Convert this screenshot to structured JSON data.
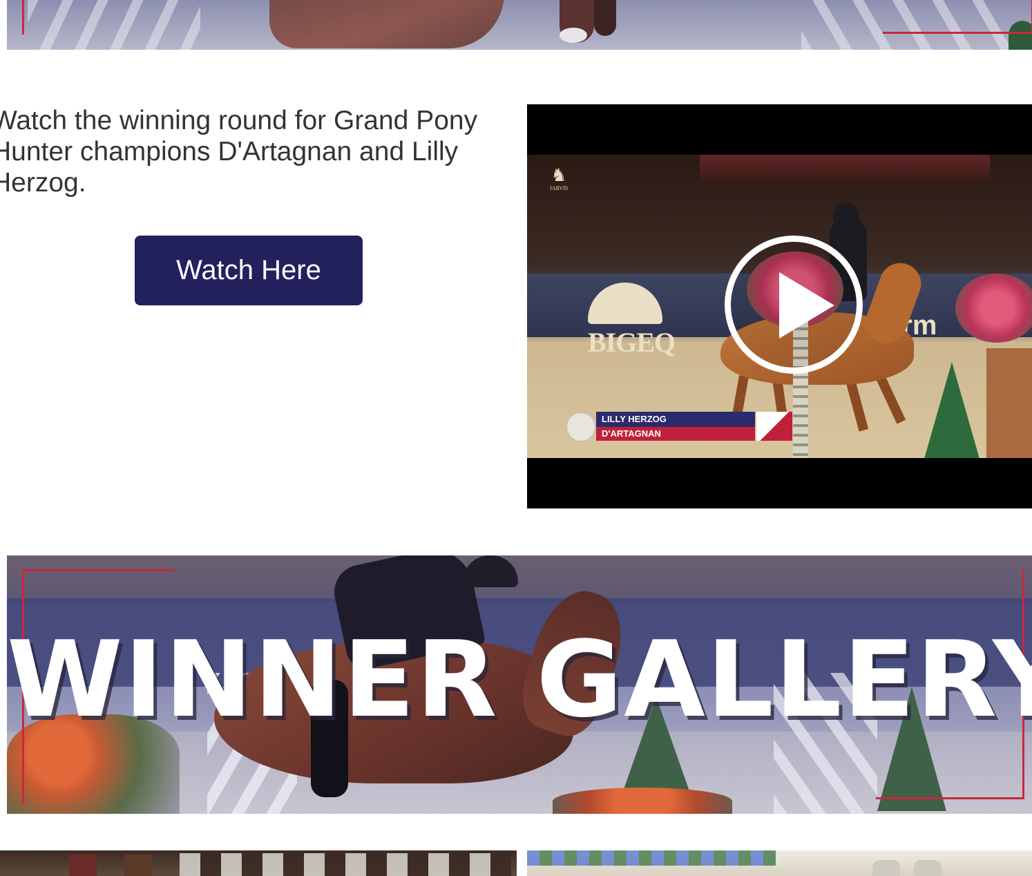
{
  "intro": {
    "text": "Watch the winning round for Grand Pony Hunter champions D'Artagnan and Lilly Herzog.",
    "button_label": "Watch Here"
  },
  "video": {
    "rider_name": "LILLY HERZOG",
    "horse_name": "D'ARTAGNAN",
    "sponsor_wall_text": "BIGEQ",
    "sponsor_wall_text_2": "arm",
    "corner_logo_text": "JARVIS",
    "play_icon": "play-icon"
  },
  "gallery": {
    "title": "WINNER GALLERY"
  },
  "colors": {
    "button_bg": "#23205e",
    "accent_red": "#c8293b",
    "lower_third_blue": "#2b2a6a",
    "lower_third_red": "#c1203a"
  }
}
